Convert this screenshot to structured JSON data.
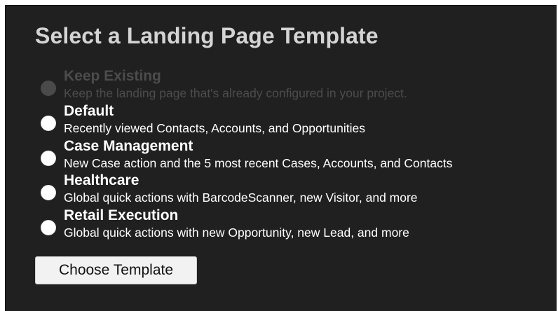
{
  "dialog": {
    "title": "Select a Landing Page Template"
  },
  "options": [
    {
      "title": "Keep Existing",
      "description": "Keep the landing page that's already configured in your project.",
      "disabled": true
    },
    {
      "title": "Default",
      "description": "Recently viewed Contacts, Accounts, and Opportunities",
      "disabled": false
    },
    {
      "title": "Case Management",
      "description": "New Case action and the 5 most recent Cases, Accounts, and Contacts",
      "disabled": false
    },
    {
      "title": "Healthcare",
      "description": "Global quick actions with BarcodeScanner, new Visitor, and more",
      "disabled": false
    },
    {
      "title": "Retail Execution",
      "description": "Global quick actions with new Opportunity, new Lead, and more",
      "disabled": false
    }
  ],
  "actions": {
    "choose_label": "Choose Template"
  },
  "colors": {
    "background": "#202020",
    "title": "#d4d4d4",
    "text": "#ffffff",
    "disabled_text": "#4c4c4c",
    "button_bg": "#f2f2f2"
  }
}
